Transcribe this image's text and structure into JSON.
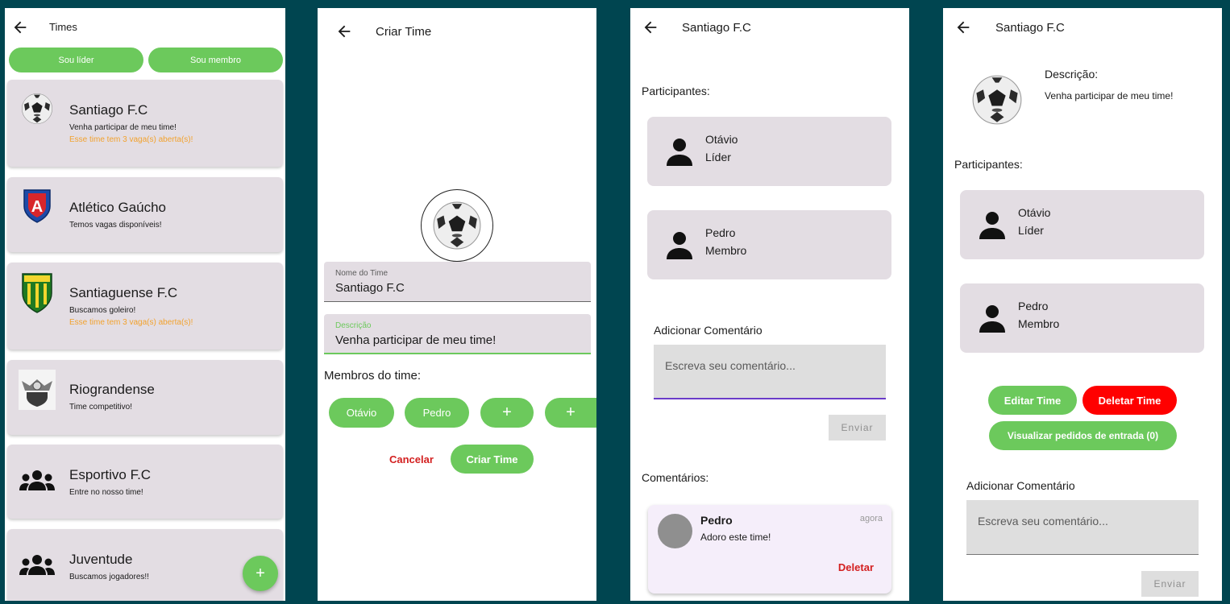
{
  "screen1": {
    "title": "Times",
    "tabs": [
      "Sou líder",
      "Sou membro"
    ],
    "teams": [
      {
        "name": "Santiago F.C",
        "desc": "Venha participar de meu time!",
        "vagas": "Esse time tem 3 vaga(s) aberta(s)!"
      },
      {
        "name": "Atlético Gaúcho",
        "desc": "Temos vagas disponíveis!",
        "vagas": ""
      },
      {
        "name": "Santiaguense F.C",
        "desc": "Buscamos goleiro!",
        "vagas": "Esse time tem 3 vaga(s) aberta(s)!"
      },
      {
        "name": "Riograndense",
        "desc": "Time competitivo!",
        "vagas": ""
      },
      {
        "name": "Esportivo F.C",
        "desc": "Entre no nosso time!",
        "vagas": ""
      },
      {
        "name": "Juventude",
        "desc": "Buscamos jogadores!!",
        "vagas": ""
      }
    ],
    "fab": "+"
  },
  "screen2": {
    "title": "Criar Time",
    "name_label": "Nome do Time",
    "name_value": "Santiago F.C",
    "desc_label": "Descrição",
    "desc_value": "Venha participar de meu time!",
    "members_label": "Membros do time:",
    "members": [
      "Otávio",
      "Pedro",
      "+",
      "+"
    ],
    "cancel": "Cancelar",
    "create": "Criar Time"
  },
  "screen3": {
    "title": "Santiago F.C",
    "participants_label": "Participantes:",
    "participants": [
      {
        "name": "Otávio",
        "role": "Líder"
      },
      {
        "name": "Pedro",
        "role": "Membro"
      }
    ],
    "add_comment_label": "Adicionar Comentário",
    "comment_placeholder": "Escreva seu comentário...",
    "send": "Enviar",
    "comments_label": "Comentários:",
    "comment": {
      "author": "Pedro",
      "time": "agora",
      "text": "Adoro este time!",
      "delete": "Deletar"
    }
  },
  "screen4": {
    "title": "Santiago F.C",
    "desc_label": "Descrição:",
    "desc_value": "Venha participar de meu time!",
    "participants_label": "Participantes:",
    "participants": [
      {
        "name": "Otávio",
        "role": "Líder"
      },
      {
        "name": "Pedro",
        "role": "Membro"
      }
    ],
    "edit": "Editar Time",
    "delete": "Deletar Time",
    "requests": "Visualizar pedidos de entrada (0)",
    "add_comment_label": "Adicionar Comentário",
    "comment_placeholder": "Escreva seu comentário...",
    "send": "Enviar"
  },
  "colors": {
    "background": "#004550",
    "accent_green": "#6cc95c",
    "card": "#e3dde3",
    "danger": "#ff0000",
    "warning_text": "#f2a22e",
    "input_focus": "#6a3bc9"
  }
}
